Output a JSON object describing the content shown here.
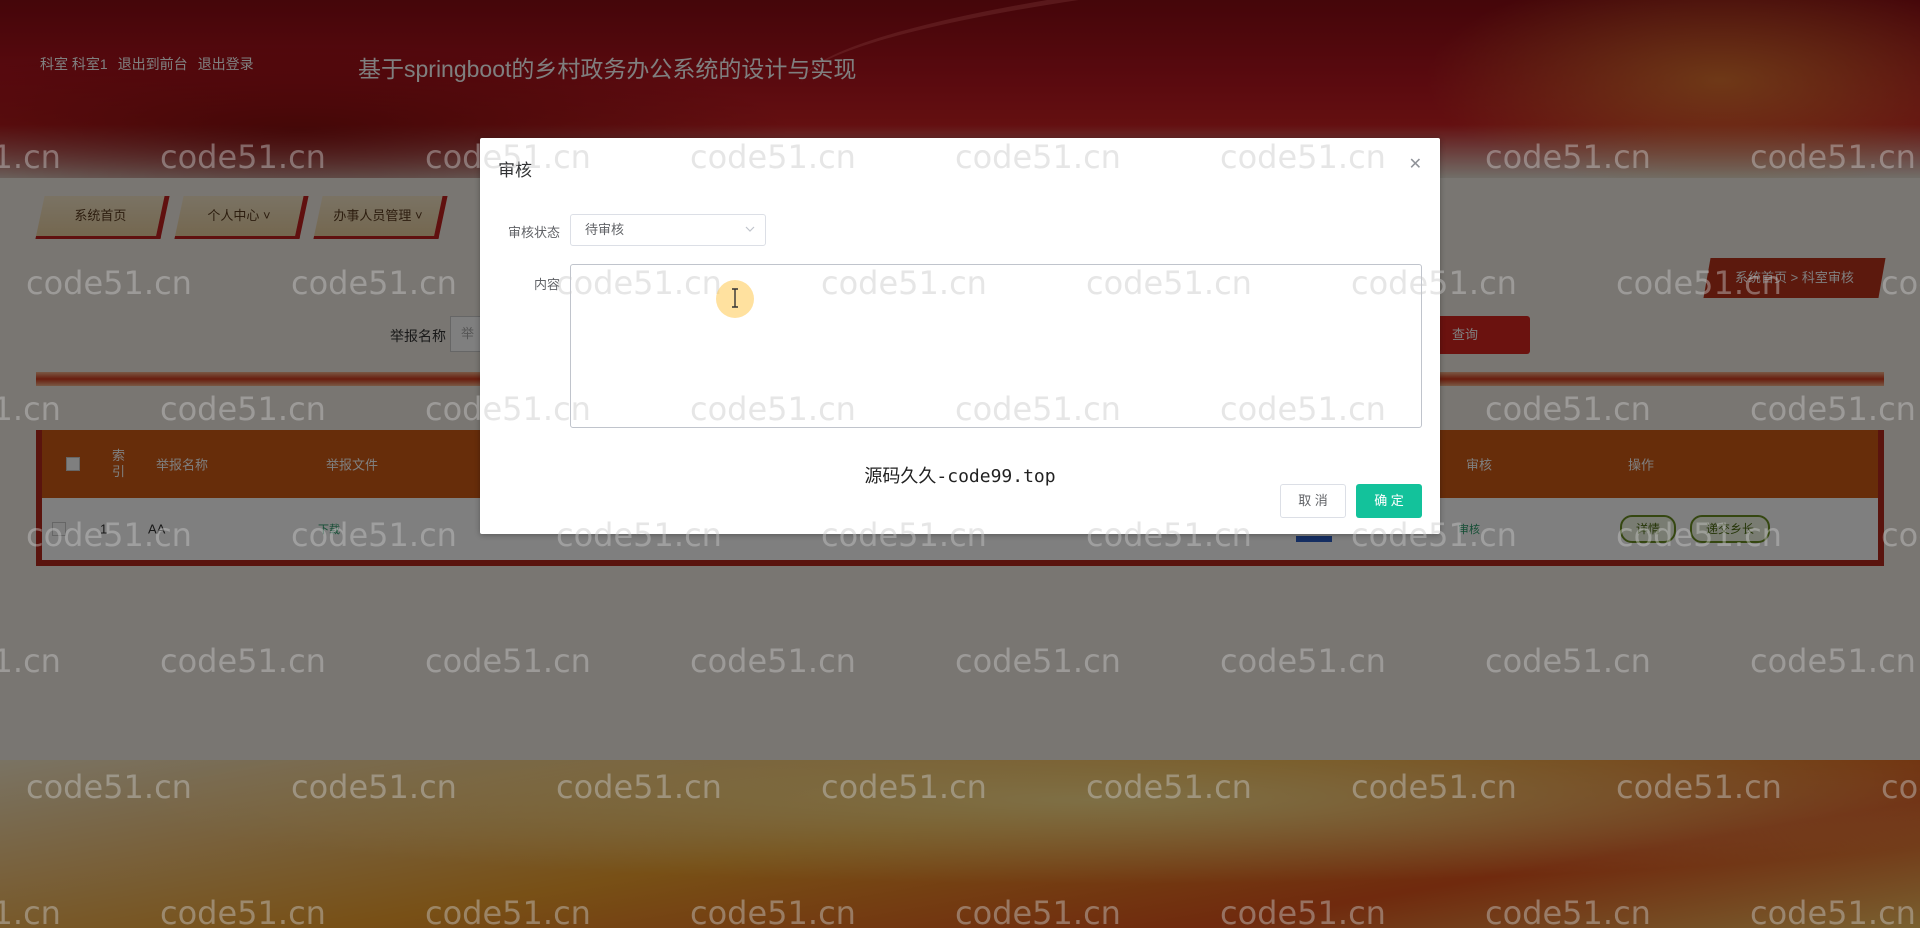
{
  "header": {
    "user_links": [
      "科室 科室1",
      "退出到前台",
      "退出登录"
    ],
    "site_title": "基于springboot的乡村政务办公系统的设计与实现"
  },
  "nav": {
    "items": [
      {
        "label": "系统首页",
        "icon": "none"
      },
      {
        "label": "个人中心",
        "icon": "chevron-down-icon"
      },
      {
        "label": "办事人员管理",
        "icon": "chevron-down-icon"
      }
    ]
  },
  "breadcrumb": {
    "home": "系统首页",
    "separator": ">",
    "current": "科室审核"
  },
  "search": {
    "label": "举报名称",
    "placeholder": "举",
    "button": "查询"
  },
  "table": {
    "columns": [
      "索引",
      "举报名称",
      "举报文件",
      "审核",
      "操作"
    ],
    "rows": [
      {
        "index": "1",
        "name": "AA",
        "file_link": "下载",
        "status_link": "审核",
        "actions": [
          "详情",
          "递交乡长"
        ]
      }
    ]
  },
  "dialog": {
    "title": "审核",
    "status_label": "审核状态",
    "status_value": "待审核",
    "content_label": "内容",
    "content_value": "",
    "cancel": "取 消",
    "confirm": "确 定",
    "footer_note": "源码久久-code99.top"
  },
  "watermark": "code51.cn",
  "colors": {
    "accent": "#13c29b",
    "brand_red": "#c0201f",
    "table_header": "#cf5a15"
  }
}
